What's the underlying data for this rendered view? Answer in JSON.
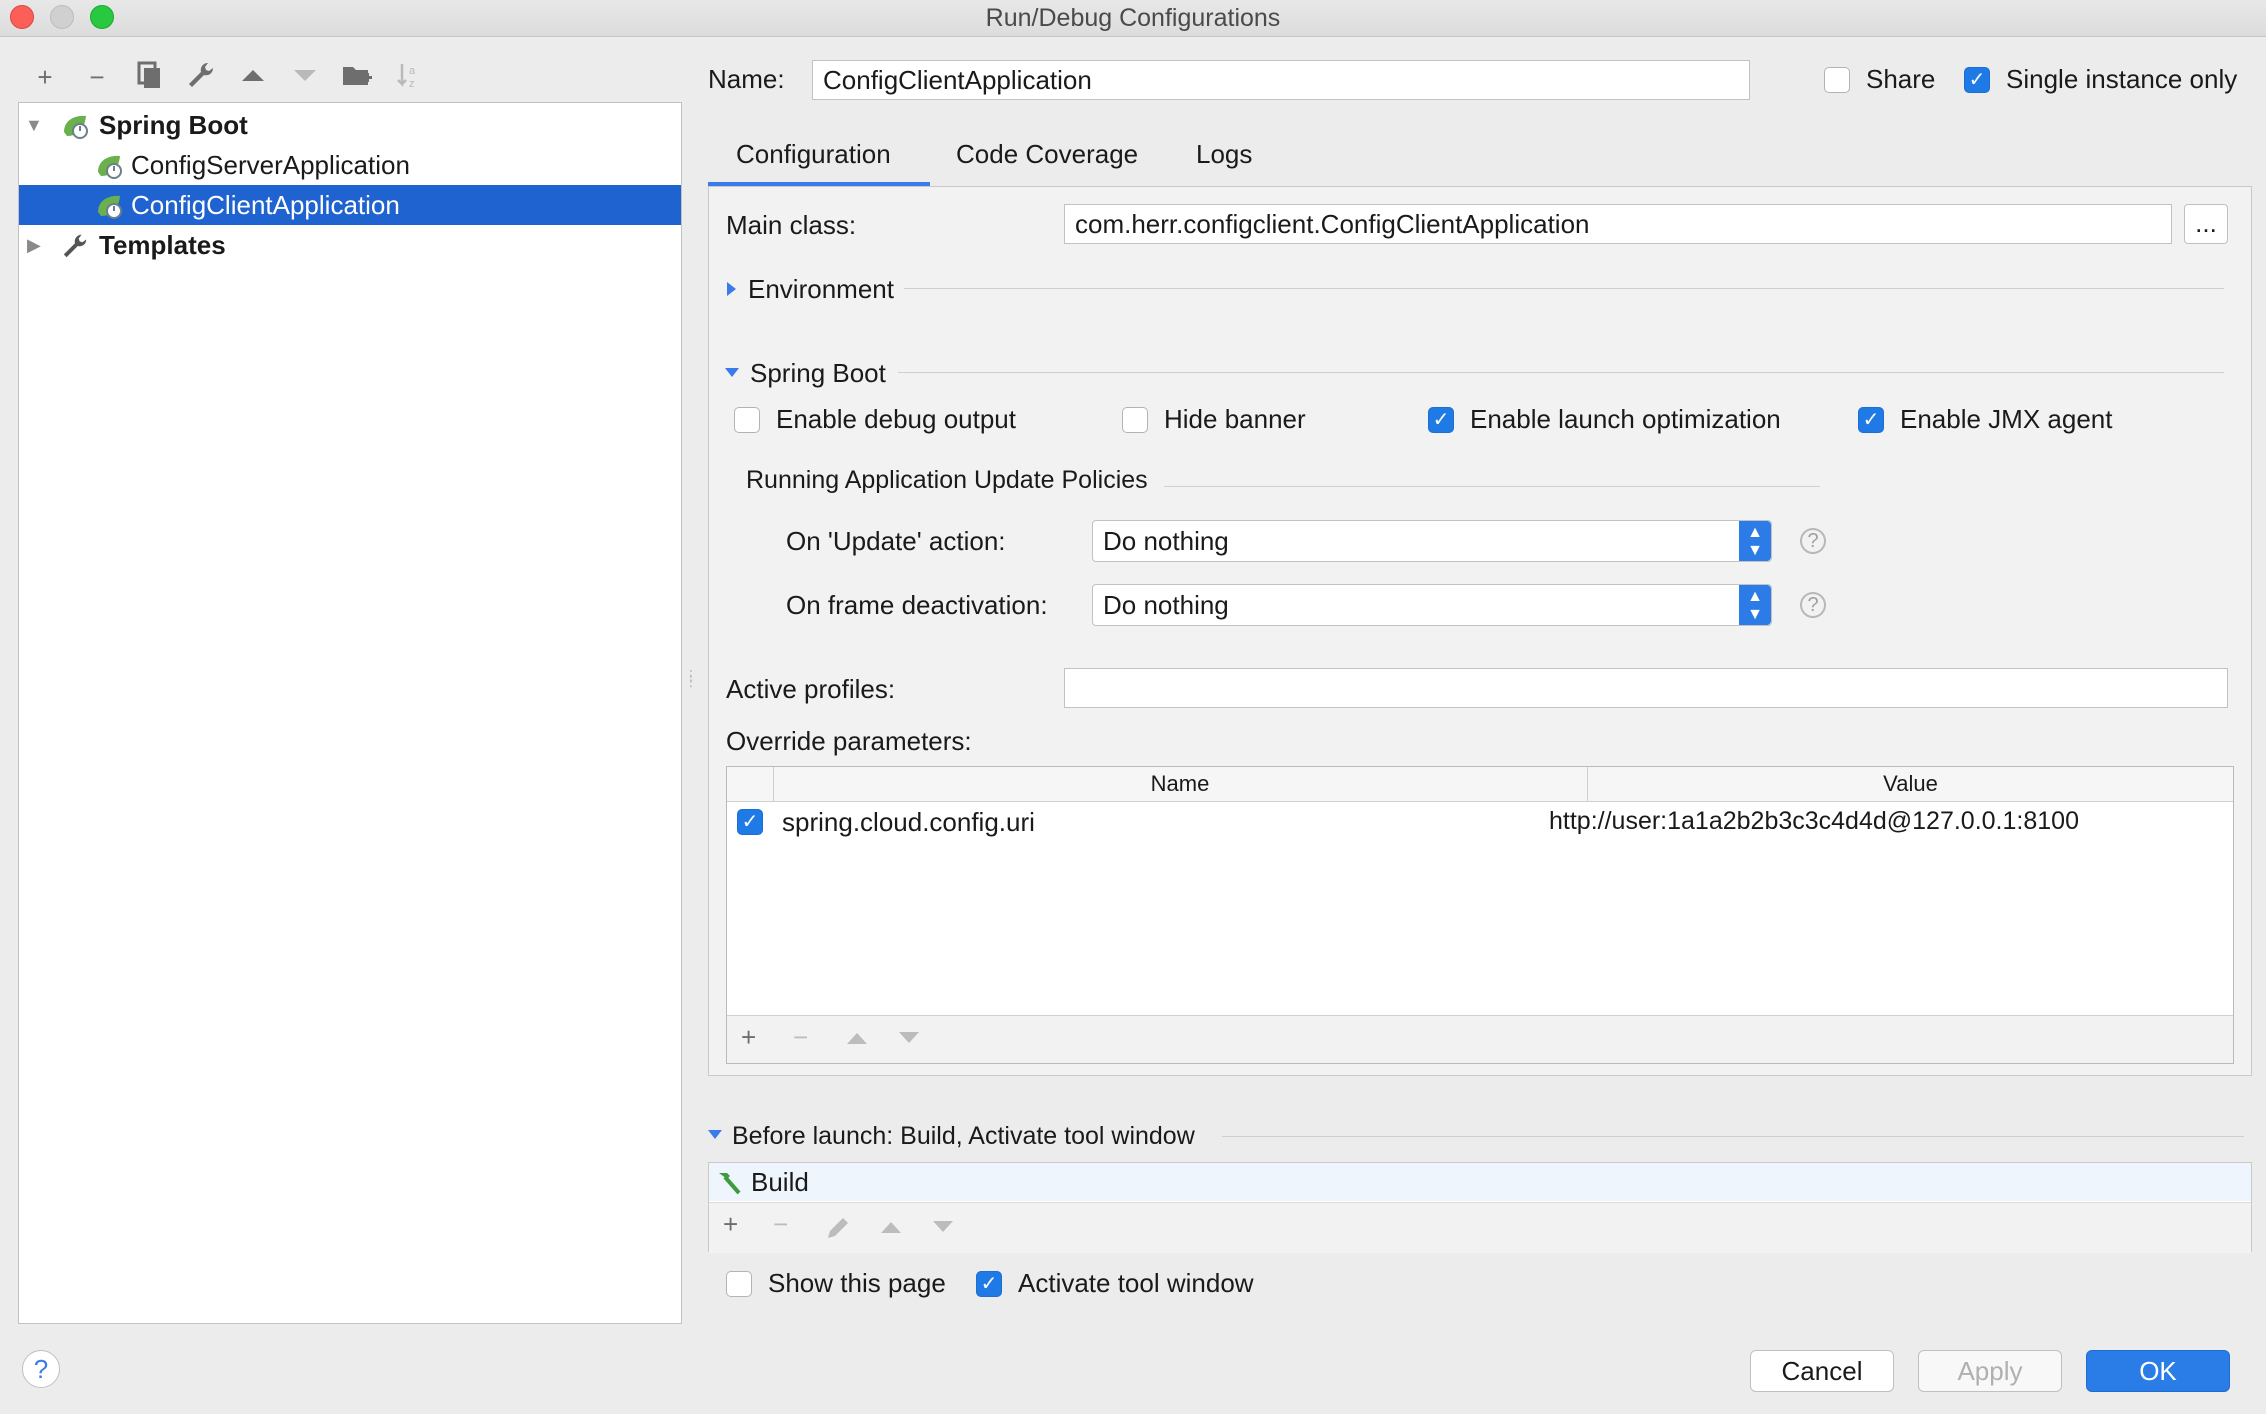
{
  "window": {
    "title": "Run/Debug Configurations"
  },
  "toolbar": {
    "icons": [
      "add-icon",
      "remove-icon",
      "copy-icon",
      "wrench-icon",
      "move-up-icon",
      "move-down-icon",
      "folder-add-icon",
      "sort-icon"
    ]
  },
  "tree": {
    "spring_boot_label": "Spring Boot",
    "items": [
      {
        "label": "ConfigServerApplication"
      },
      {
        "label": "ConfigClientApplication",
        "selected": true
      }
    ],
    "templates_label": "Templates"
  },
  "header": {
    "name_label": "Name:",
    "name_value": "ConfigClientApplication",
    "share_label": "Share",
    "share_checked": false,
    "single_instance_label": "Single instance only",
    "single_instance_checked": true
  },
  "tabs": [
    {
      "label": "Configuration",
      "active": true
    },
    {
      "label": "Code Coverage",
      "active": false
    },
    {
      "label": "Logs",
      "active": false
    }
  ],
  "config": {
    "main_class_label": "Main class:",
    "main_class_value": "com.herr.configclient.ConfigClientApplication",
    "browse_label": "...",
    "environment_label": "Environment",
    "spring_boot_section_label": "Spring Boot",
    "options": [
      {
        "label": "Enable debug output",
        "checked": false
      },
      {
        "label": "Hide banner",
        "checked": false
      },
      {
        "label": "Enable launch optimization",
        "checked": true
      },
      {
        "label": "Enable JMX agent",
        "checked": true
      }
    ],
    "update_policies_label": "Running Application Update Policies",
    "on_update_label": "On 'Update' action:",
    "on_update_value": "Do nothing",
    "on_frame_label": "On frame deactivation:",
    "on_frame_value": "Do nothing",
    "help_glyph": "?",
    "active_profiles_label": "Active profiles:",
    "active_profiles_value": "",
    "override_label": "Override parameters:",
    "table": {
      "headers": [
        "Name",
        "Value"
      ],
      "rows": [
        {
          "checked": true,
          "name": "spring.cloud.config.uri",
          "value": "http://user:1a1a2b2b3c3c4d4d@127.0.0.1:8100"
        }
      ]
    }
  },
  "before_launch": {
    "label": "Before launch: Build, Activate tool window",
    "items": [
      {
        "label": "Build"
      }
    ]
  },
  "footer": {
    "show_page_label": "Show this page",
    "show_page_checked": false,
    "activate_tool_label": "Activate tool window",
    "activate_tool_checked": true,
    "help_glyph": "?",
    "cancel_label": "Cancel",
    "apply_label": "Apply",
    "ok_label": "OK"
  },
  "colors": {
    "accent": "#2a7de6",
    "selection": "#1e63cf",
    "window_bg": "#ececec"
  }
}
